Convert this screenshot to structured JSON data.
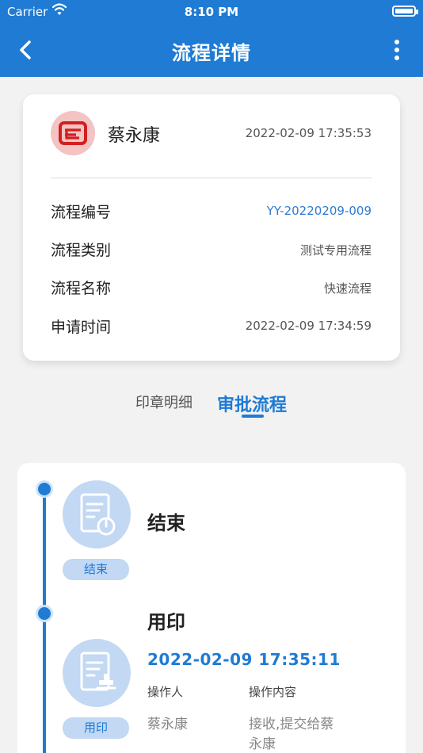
{
  "status_bar": {
    "carrier": "Carrier",
    "time": "8:10 PM"
  },
  "header": {
    "title": "流程详情",
    "back_icon": "chevron-left-icon",
    "more_icon": "more-vertical-icon"
  },
  "info": {
    "user_name": "蔡永康",
    "created_time": "2022-02-09 17:35:53",
    "rows": [
      {
        "label": "流程编号",
        "value": "YY-20220209-009"
      },
      {
        "label": "流程类别",
        "value": "测试专用流程"
      },
      {
        "label": "流程名称",
        "value": "快速流程"
      },
      {
        "label": "申请时间",
        "value": "2022-02-09 17:34:59"
      }
    ]
  },
  "tabs": {
    "items": [
      "印章明细",
      "审批流程"
    ],
    "active_index": 1
  },
  "flow": {
    "steps": [
      {
        "badge": "结束",
        "title": "结束"
      },
      {
        "badge": "用印",
        "title": "用印",
        "time": "2022-02-09 17:35:11",
        "col_operator": "操作人",
        "col_content": "操作内容",
        "operator": "蔡永康",
        "content_line1": "接收,提交给蔡",
        "content_line2": "永康"
      }
    ]
  },
  "colors": {
    "primary": "#1f7bd4",
    "light": "#c2d8f3",
    "background": "#f2f2f2"
  }
}
